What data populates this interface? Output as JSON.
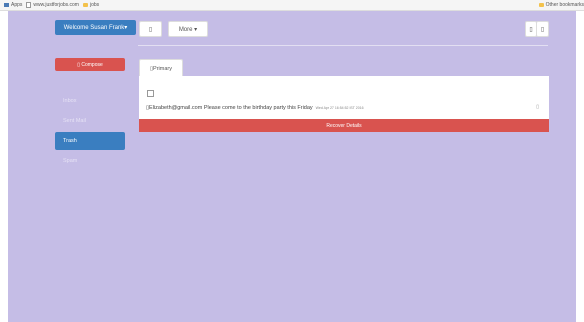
{
  "bookmarks": {
    "apps": "Apps",
    "site": "www.justforjobs.com",
    "folder": "jobs",
    "other": "Other bookmarks"
  },
  "toolbar": {
    "welcome": "Welcome Susan Frank▾",
    "icon_button": "▯",
    "more": "More ▾",
    "prev": "▯",
    "next": "▯"
  },
  "sidebar": {
    "compose": "▯ Compose",
    "items": [
      {
        "label": "Inbox"
      },
      {
        "label": "Sent Mail"
      },
      {
        "label": "Trash"
      },
      {
        "label": "Spam"
      }
    ]
  },
  "tabs": {
    "primary": "▯Primary"
  },
  "email": {
    "text": "▯Elizabeth@gmail.com Please come to the birthday party this Friday",
    "time": "Wed Apr 27 16:54:52 IST 2016",
    "icon": "▯"
  },
  "recover": {
    "label": "Recover Details"
  },
  "colors": {
    "background": "#c5bde6",
    "primary": "#3a7ec0",
    "danger": "#d9534f"
  }
}
